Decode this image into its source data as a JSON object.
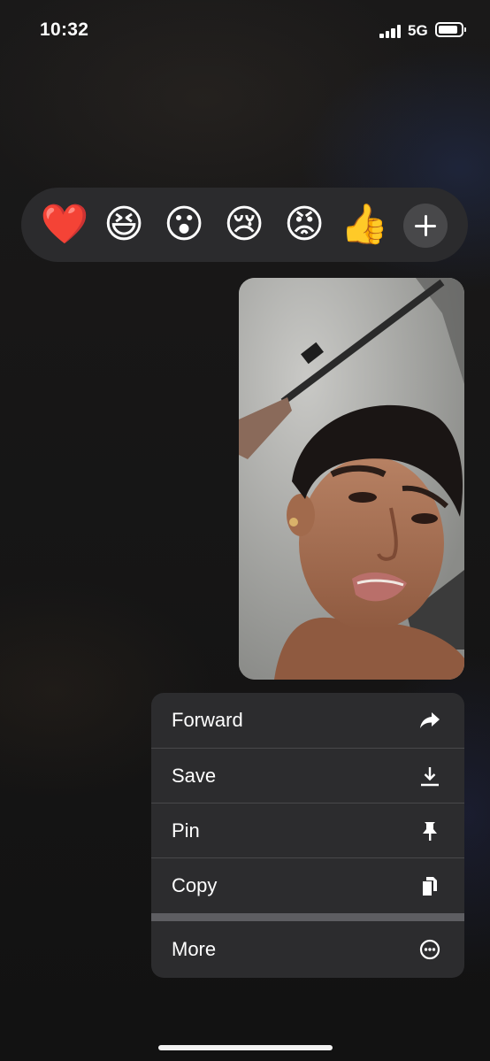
{
  "status_bar": {
    "time": "10:32",
    "network": "5G",
    "signal_bars": 4,
    "battery_level": 0.8
  },
  "reactions": [
    {
      "name": "heart",
      "glyph": "❤️"
    },
    {
      "name": "laughing",
      "glyph": "😆"
    },
    {
      "name": "surprised",
      "glyph": "😮"
    },
    {
      "name": "sad-tear",
      "glyph": "😢"
    },
    {
      "name": "angry",
      "glyph": "😡"
    },
    {
      "name": "thumbs-up",
      "glyph": "👍"
    }
  ],
  "add_reaction_icon": "plus-icon",
  "message": {
    "type": "photo",
    "subject": "selfie"
  },
  "menu": {
    "items": [
      {
        "label": "Forward",
        "icon": "forward-arrow-icon"
      },
      {
        "label": "Save",
        "icon": "download-icon"
      },
      {
        "label": "Pin",
        "icon": "pin-icon"
      },
      {
        "label": "Copy",
        "icon": "copy-icon"
      },
      {
        "label": "More",
        "icon": "more-ellipsis-icon"
      }
    ]
  },
  "colors": {
    "background": "#141414",
    "reaction_bar": "#2b2b2d",
    "menu_background": "#2c2c2e",
    "menu_separator": "#5e5e62"
  }
}
